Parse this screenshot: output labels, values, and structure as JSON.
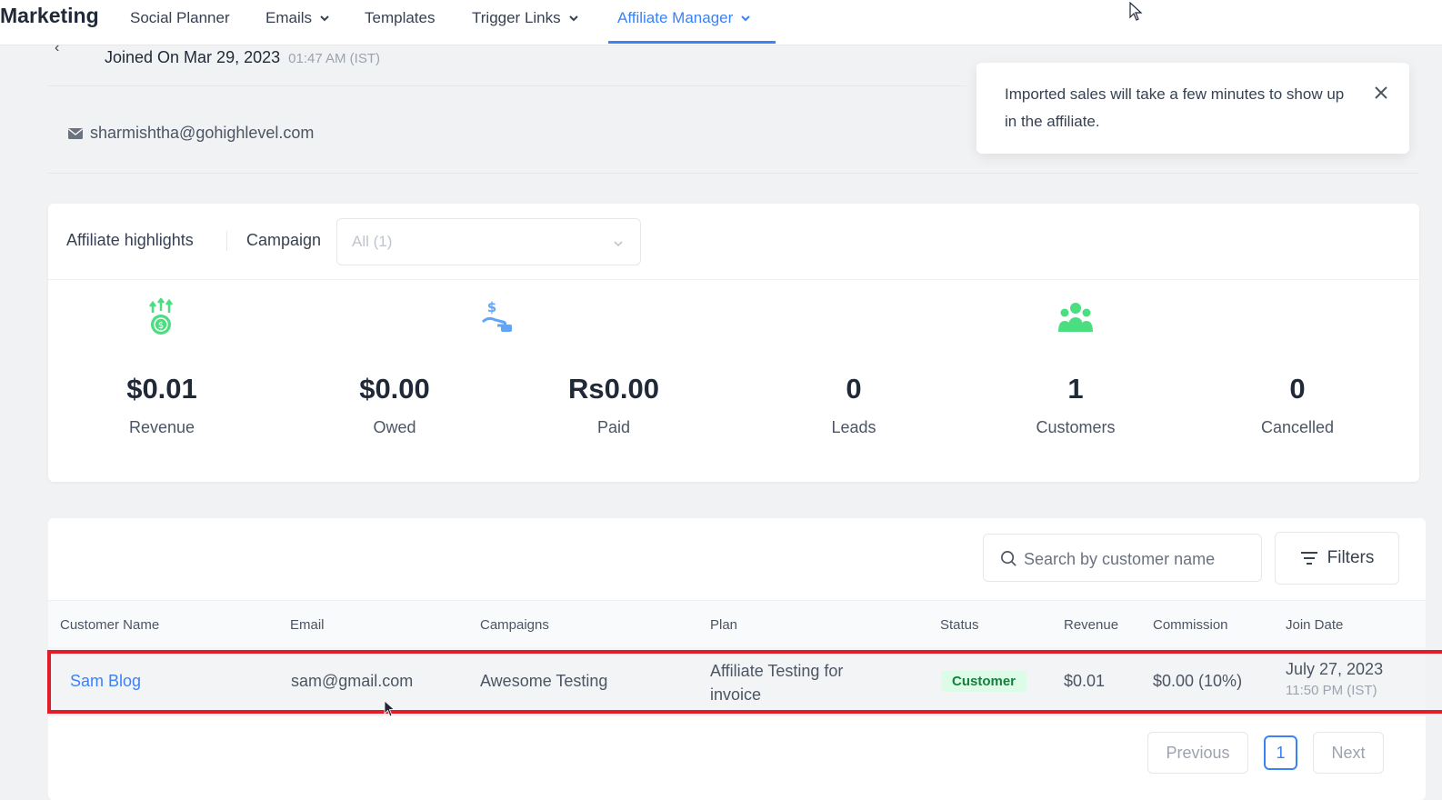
{
  "nav": {
    "brand": "Marketing",
    "items": [
      {
        "label": "Social Planner"
      },
      {
        "label": "Emails"
      },
      {
        "label": "Templates"
      },
      {
        "label": "Trigger Links"
      },
      {
        "label": "Affiliate Manager"
      }
    ]
  },
  "profile": {
    "joined_label": "Joined On Mar 29, 2023",
    "joined_time": "01:47 AM (IST)",
    "email": "sharmishtha@gohighlevel.com"
  },
  "toast": {
    "message": "Imported sales will take a few minutes to show up in the affiliate."
  },
  "highlights": {
    "title": "Affiliate highlights",
    "campaign_label": "Campaign",
    "campaign_value": "All (1)",
    "stats": [
      {
        "value": "$0.01",
        "label": "Revenue",
        "icon": "money-growth-icon"
      },
      {
        "value": "$0.00",
        "label": "Owed",
        "icon": ""
      },
      {
        "value": "Rs0.00",
        "label": "Paid",
        "icon": "hand-dollar-icon"
      },
      {
        "value": "0",
        "label": "Leads",
        "icon": ""
      },
      {
        "value": "1",
        "label": "Customers",
        "icon": "group-icon"
      },
      {
        "value": "0",
        "label": "Cancelled",
        "icon": ""
      }
    ],
    "colors": {
      "green": "#4ade80",
      "blue": "#60a5fa"
    }
  },
  "table": {
    "search_placeholder": "Search by customer name",
    "filters_label": "Filters",
    "headers": {
      "name": "Customer Name",
      "email": "Email",
      "campaigns": "Campaigns",
      "plan": "Plan",
      "status": "Status",
      "revenue": "Revenue",
      "commission": "Commission",
      "join_date": "Join Date"
    },
    "rows": [
      {
        "name": "Sam Blog",
        "email": "sam@gmail.com",
        "campaign": "Awesome Testing",
        "plan": "Affiliate Testing for invoice",
        "status": "Customer",
        "revenue": "$0.01",
        "commission": "$0.00 (10%)",
        "join_date": "July 27, 2023",
        "join_time": "11:50 PM (IST)"
      }
    ],
    "pagination": {
      "previous": "Previous",
      "page": "1",
      "next": "Next"
    }
  }
}
